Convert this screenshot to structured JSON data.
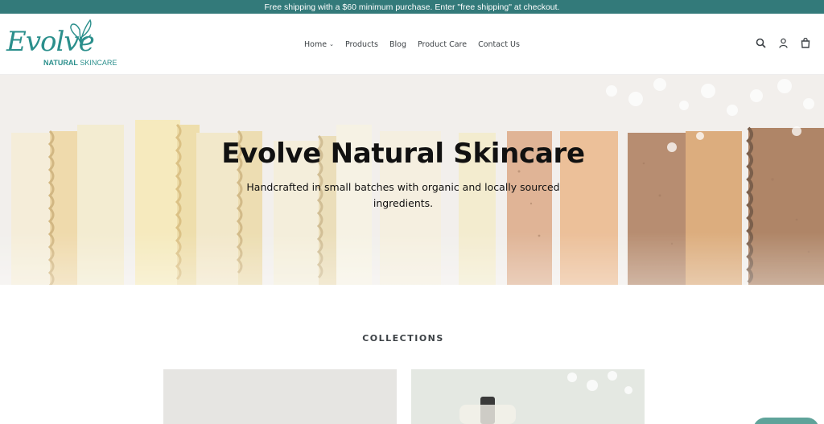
{
  "announcement": {
    "text": "Free shipping with a $60 minimum purchase. Enter \"free shipping\" at checkout."
  },
  "logo": {
    "name": "Evolve",
    "tagline_bold": "NATURAL",
    "tagline": " SKINCARE"
  },
  "nav": {
    "items": [
      {
        "label": "Home",
        "has_dropdown": true
      },
      {
        "label": "Products"
      },
      {
        "label": "Blog"
      },
      {
        "label": "Product Care"
      },
      {
        "label": "Contact Us"
      }
    ]
  },
  "header_icons": [
    "search-icon",
    "account-icon",
    "cart-icon"
  ],
  "hero": {
    "title": "Evolve Natural Skincare",
    "subtitle": "Handcrafted in small batches with organic and locally sourced ingredients."
  },
  "collections": {
    "title": "COLLECTIONS"
  },
  "colors": {
    "brand_teal": "#337a7a",
    "logo_teal": "#2b8f8c"
  }
}
